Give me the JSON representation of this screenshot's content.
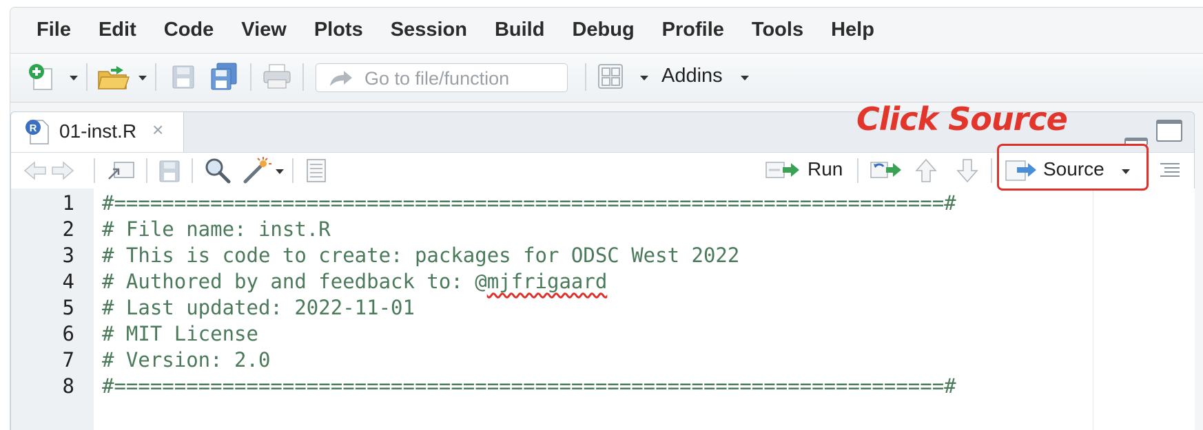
{
  "menu": [
    "File",
    "Edit",
    "Code",
    "View",
    "Plots",
    "Session",
    "Build",
    "Debug",
    "Profile",
    "Tools",
    "Help"
  ],
  "toolbar": {
    "goto_placeholder": "Go to file/function",
    "addins_label": "Addins"
  },
  "editor": {
    "tab_label": "01-inst.R",
    "tab_close": "×",
    "run_label": "Run",
    "source_label": "Source",
    "annotation": "Click Source",
    "lines": [
      {
        "num": "1",
        "text": "#=====================================================================#"
      },
      {
        "num": "2",
        "text": "# File name: inst.R"
      },
      {
        "num": "3",
        "text": "# This is code to create: packages for ODSC West 2022"
      },
      {
        "num": "4",
        "text_before": "# Authored by and feedback to: @",
        "text_squiggle": "mjfrigaard"
      },
      {
        "num": "5",
        "text": "# Last updated: 2022-11-01"
      },
      {
        "num": "6",
        "text": "# MIT License"
      },
      {
        "num": "7",
        "text": "# Version: 2.0"
      },
      {
        "num": "8",
        "text": "#=====================================================================#"
      }
    ]
  },
  "colors": {
    "highlight": "#e0302a",
    "comment": "#4a7a5a"
  }
}
